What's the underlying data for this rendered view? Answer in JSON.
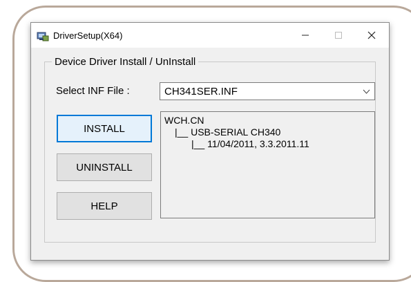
{
  "window": {
    "title": "DriverSetup(X64)",
    "controls": {
      "minimize": "—",
      "maximize": "☐",
      "close": "✕"
    }
  },
  "group": {
    "label": "Device Driver Install / UnInstall"
  },
  "inf": {
    "label": "Select INF File :",
    "value": "CH341SER.INF"
  },
  "buttons": {
    "install": "INSTALL",
    "uninstall": "UNINSTALL",
    "help": "HELP"
  },
  "info": {
    "lines": [
      "WCH.CN",
      "|__ USB-SERIAL CH340",
      "|__ 11/04/2011, 3.3.2011.11"
    ]
  },
  "icons": {
    "app": "driver-setup-icon",
    "dropdown": "chevron-down-icon"
  },
  "colors": {
    "accent": "#0078d7",
    "window_bg": "#f0f0f0",
    "frame": "#b9a89a"
  }
}
